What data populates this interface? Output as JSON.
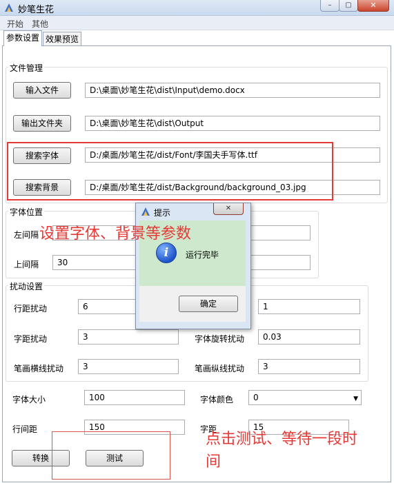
{
  "window": {
    "title": "妙笔生花",
    "min": "–",
    "max": "▢",
    "close": "✕"
  },
  "menu": [
    "开始",
    "其他"
  ],
  "tabs": [
    "参数设置",
    "效果预览"
  ],
  "file_group": {
    "title": "文件管理",
    "rows": [
      {
        "button": "输入文件",
        "value": "D:\\桌面\\妙笔生花\\dist\\Input\\demo.docx"
      },
      {
        "button": "输出文件夹",
        "value": "D:\\桌面\\妙笔生花\\dist\\Output"
      },
      {
        "button": "搜索字体",
        "value": "D:/桌面/妙笔生花/dist/Font/李国夫手写体.ttf"
      },
      {
        "button": "搜索背景",
        "value": "D:/桌面/妙笔生花/dist/Background/background_03.jpg"
      }
    ]
  },
  "font_pos": {
    "title": "字体位置",
    "left_label": "左间隔",
    "left_value": "",
    "top_label": "上间隔",
    "top_value": "30",
    "right_value": "",
    "bottom_value": ""
  },
  "disturb": {
    "title": "扰动设置",
    "line_spacing_label": "行距扰动",
    "line_spacing_value": "6",
    "right1_value": "1",
    "char_spacing_label": "字距扰动",
    "char_spacing_value": "3",
    "rotation_label": "字体旋转扰动",
    "rotation_value": "0.03",
    "stroke_h_label": "笔画横线扰动",
    "stroke_h_value": "3",
    "stroke_v_label": "笔画纵线扰动",
    "stroke_v_value": "3"
  },
  "font_size": {
    "label": "字体大小",
    "value": "100"
  },
  "font_color": {
    "label": "字体颜色",
    "value": "0"
  },
  "line_gap": {
    "label": "行间距",
    "value": "150"
  },
  "char_gap": {
    "label": "字距",
    "value": "15"
  },
  "actions": {
    "convert": "转换",
    "test": "测试"
  },
  "dialog": {
    "title": "提示",
    "message": "运行完毕",
    "ok": "确定",
    "close": "✕"
  },
  "annotations": {
    "params": "设置字体、背景等参数",
    "test_line1": "点击测试、等待一段时",
    "test_line2": "间"
  },
  "colors": {
    "annotation": "#e53935",
    "dialog_body": "#cde8cd"
  }
}
